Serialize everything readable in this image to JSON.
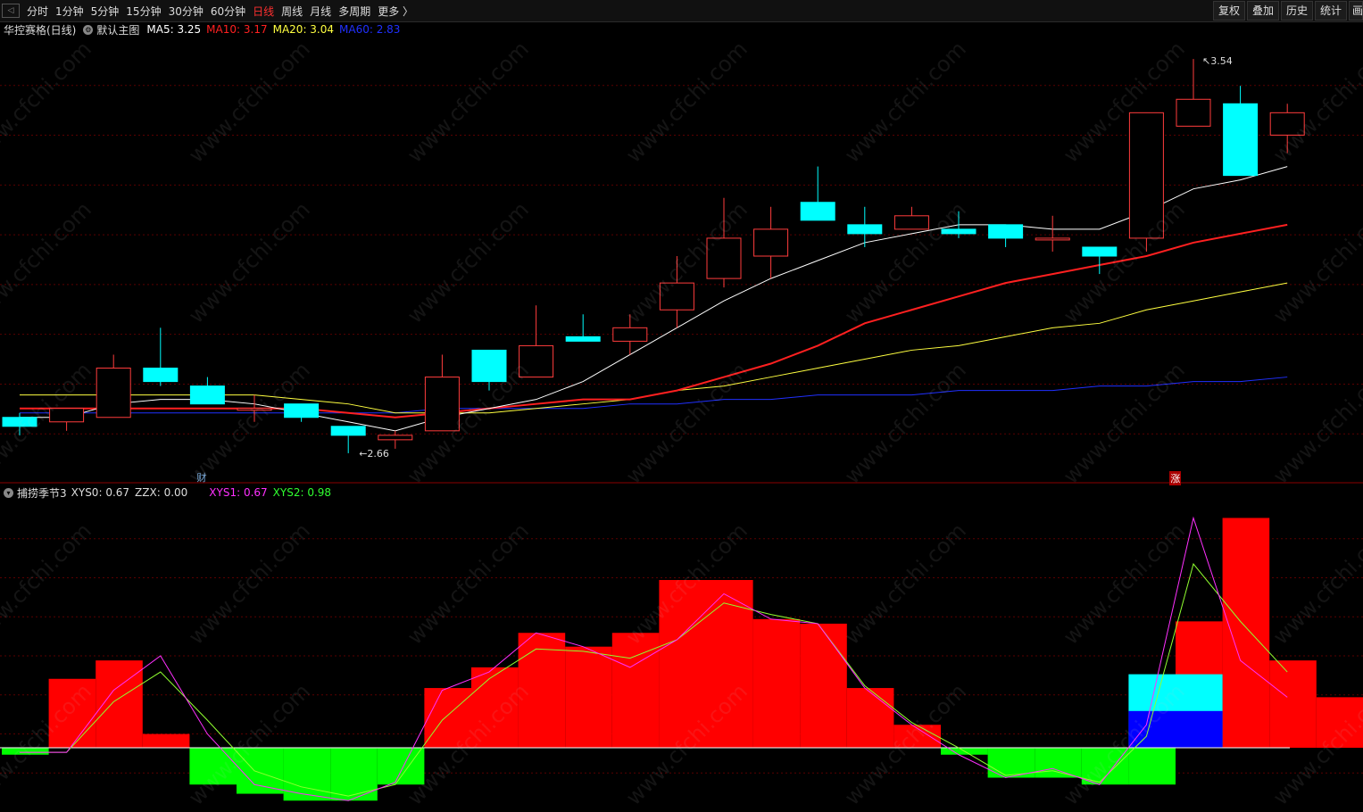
{
  "toolbar": {
    "corner_glyph": "◁",
    "periods": [
      "分时",
      "1分钟",
      "5分钟",
      "15分钟",
      "30分钟",
      "60分钟",
      "日线",
      "周线",
      "月线",
      "多周期",
      "更多 〉"
    ],
    "active_period": "日线",
    "right_buttons": [
      "复权",
      "叠加",
      "历史",
      "统计",
      "画"
    ]
  },
  "main_panel": {
    "stock_title": "华控赛格(日线)",
    "chart_name": "默认主图",
    "ma_values": [
      {
        "label": "MA5",
        "value": "3.25",
        "color": "#ffffff"
      },
      {
        "label": "MA10",
        "value": "3.17",
        "color": "#ff2020"
      },
      {
        "label": "MA20",
        "value": "3.04",
        "color": "#ffff40"
      },
      {
        "label": "MA60",
        "value": "2.83",
        "color": "#2030ff"
      }
    ],
    "high_label": "3.54",
    "low_label": "2.66",
    "marker_cai": "财",
    "marker_zhang": "涨"
  },
  "sub_panel": {
    "indicator_name": "捕捞季节3",
    "values": [
      {
        "label": "XYS0",
        "value": "0.67",
        "color": "#dddddd"
      },
      {
        "label": "ZZX",
        "value": "0.00",
        "color": "#dddddd"
      },
      {
        "label": "XYS1",
        "value": "0.67",
        "color": "#ff30ff"
      },
      {
        "label": "XYS2",
        "value": "0.98",
        "color": "#30ff30"
      }
    ]
  },
  "watermark": "www.cfchi.com",
  "colors": {
    "up": "#ff3c3c",
    "down": "#00ffff",
    "ma5": "#ffffff",
    "ma10": "#ff2020",
    "ma20": "#ffff40",
    "ma60": "#2030ff",
    "hist_pos": "#ff0000",
    "hist_neg": "#00ff00",
    "hist_cyan": "#00ffff",
    "hist_blue": "#0000ff"
  },
  "chart_data": {
    "type": "candlestick",
    "candles": [
      {
        "o": 2.74,
        "c": 2.72,
        "h": 2.75,
        "l": 2.7
      },
      {
        "o": 2.73,
        "c": 2.76,
        "h": 2.76,
        "l": 2.71
      },
      {
        "o": 2.74,
        "c": 2.85,
        "h": 2.88,
        "l": 2.74
      },
      {
        "o": 2.85,
        "c": 2.82,
        "h": 2.94,
        "l": 2.81
      },
      {
        "o": 2.81,
        "c": 2.77,
        "h": 2.83,
        "l": 2.77
      },
      {
        "o": 2.76,
        "c": 2.76,
        "h": 2.79,
        "l": 2.73
      },
      {
        "o": 2.77,
        "c": 2.74,
        "h": 2.77,
        "l": 2.73
      },
      {
        "o": 2.72,
        "c": 2.7,
        "h": 2.72,
        "l": 2.66
      },
      {
        "o": 2.69,
        "c": 2.7,
        "h": 2.71,
        "l": 2.67
      },
      {
        "o": 2.71,
        "c": 2.83,
        "h": 2.88,
        "l": 2.71
      },
      {
        "o": 2.89,
        "c": 2.82,
        "h": 2.89,
        "l": 2.8
      },
      {
        "o": 2.83,
        "c": 2.9,
        "h": 2.99,
        "l": 2.83
      },
      {
        "o": 2.92,
        "c": 2.91,
        "h": 2.97,
        "l": 2.91
      },
      {
        "o": 2.91,
        "c": 2.94,
        "h": 2.97,
        "l": 2.88
      },
      {
        "o": 2.98,
        "c": 3.04,
        "h": 3.1,
        "l": 2.94
      },
      {
        "o": 3.05,
        "c": 3.14,
        "h": 3.23,
        "l": 3.03
      },
      {
        "o": 3.1,
        "c": 3.16,
        "h": 3.21,
        "l": 3.05
      },
      {
        "o": 3.22,
        "c": 3.18,
        "h": 3.3,
        "l": 3.18
      },
      {
        "o": 3.17,
        "c": 3.15,
        "h": 3.21,
        "l": 3.12
      },
      {
        "o": 3.16,
        "c": 3.19,
        "h": 3.21,
        "l": 3.16
      },
      {
        "o": 3.16,
        "c": 3.15,
        "h": 3.2,
        "l": 3.14
      },
      {
        "o": 3.17,
        "c": 3.14,
        "h": 3.17,
        "l": 3.12
      },
      {
        "o": 3.14,
        "c": 3.14,
        "h": 3.19,
        "l": 3.11
      },
      {
        "o": 3.12,
        "c": 3.1,
        "h": 3.12,
        "l": 3.06
      },
      {
        "o": 3.14,
        "c": 3.42,
        "h": 3.42,
        "l": 3.11
      },
      {
        "o": 3.39,
        "c": 3.45,
        "h": 3.54,
        "l": 3.39
      },
      {
        "o": 3.44,
        "c": 3.28,
        "h": 3.48,
        "l": 3.28
      },
      {
        "o": 3.37,
        "c": 3.42,
        "h": 3.44,
        "l": 3.33
      }
    ],
    "ma5": [
      2.74,
      2.74,
      2.77,
      2.78,
      2.78,
      2.77,
      2.75,
      2.73,
      2.71,
      2.74,
      2.76,
      2.78,
      2.82,
      2.88,
      2.94,
      3.0,
      3.05,
      3.09,
      3.13,
      3.15,
      3.17,
      3.17,
      3.16,
      3.16,
      3.2,
      3.25,
      3.27,
      3.3
    ],
    "ma10": [
      2.76,
      2.76,
      2.76,
      2.76,
      2.76,
      2.76,
      2.76,
      2.75,
      2.74,
      2.75,
      2.76,
      2.77,
      2.78,
      2.78,
      2.8,
      2.83,
      2.86,
      2.9,
      2.95,
      2.98,
      3.01,
      3.04,
      3.06,
      3.08,
      3.1,
      3.13,
      3.15,
      3.17
    ],
    "ma20": [
      2.79,
      2.79,
      2.79,
      2.79,
      2.79,
      2.79,
      2.78,
      2.77,
      2.75,
      2.75,
      2.75,
      2.76,
      2.77,
      2.78,
      2.8,
      2.81,
      2.83,
      2.85,
      2.87,
      2.89,
      2.9,
      2.92,
      2.94,
      2.95,
      2.98,
      3.0,
      3.02,
      3.04
    ],
    "ma60": [
      2.75,
      2.75,
      2.75,
      2.75,
      2.75,
      2.75,
      2.75,
      2.75,
      2.75,
      2.76,
      2.76,
      2.76,
      2.76,
      2.77,
      2.77,
      2.78,
      2.78,
      2.79,
      2.79,
      2.79,
      2.8,
      2.8,
      2.8,
      2.81,
      2.81,
      2.82,
      2.82,
      2.83
    ],
    "price_range": [
      2.62,
      3.58
    ],
    "sub_bars": [
      -0.03,
      0.3,
      0.38,
      0.06,
      -0.16,
      -0.2,
      -0.23,
      -0.23,
      -0.16,
      0.26,
      0.35,
      0.5,
      0.44,
      0.5,
      0.73,
      0.73,
      0.56,
      0.54,
      0.26,
      0.1,
      -0.03,
      -0.13,
      -0.13,
      -0.16,
      -0.16,
      0.55,
      1.0,
      0.38,
      0.22
    ],
    "sub_bar_overlay": {
      "index": 24,
      "cyan_top": 0.32,
      "blue_top": 0.16
    },
    "xys1": [
      -0.02,
      -0.02,
      0.25,
      0.4,
      0.06,
      -0.16,
      -0.2,
      -0.23,
      -0.15,
      0.25,
      0.33,
      0.5,
      0.44,
      0.35,
      0.47,
      0.67,
      0.56,
      0.54,
      0.26,
      0.1,
      -0.03,
      -0.13,
      -0.09,
      -0.16,
      0.1,
      1.0,
      0.38,
      0.22
    ],
    "xys2": [
      -0.02,
      -0.02,
      0.2,
      0.33,
      0.12,
      -0.1,
      -0.17,
      -0.21,
      -0.16,
      0.12,
      0.3,
      0.43,
      0.42,
      0.39,
      0.47,
      0.63,
      0.58,
      0.54,
      0.27,
      0.11,
      0.0,
      -0.12,
      -0.1,
      -0.15,
      0.05,
      0.8,
      0.55,
      0.33
    ],
    "sub_range": [
      -0.26,
      1.06
    ]
  }
}
